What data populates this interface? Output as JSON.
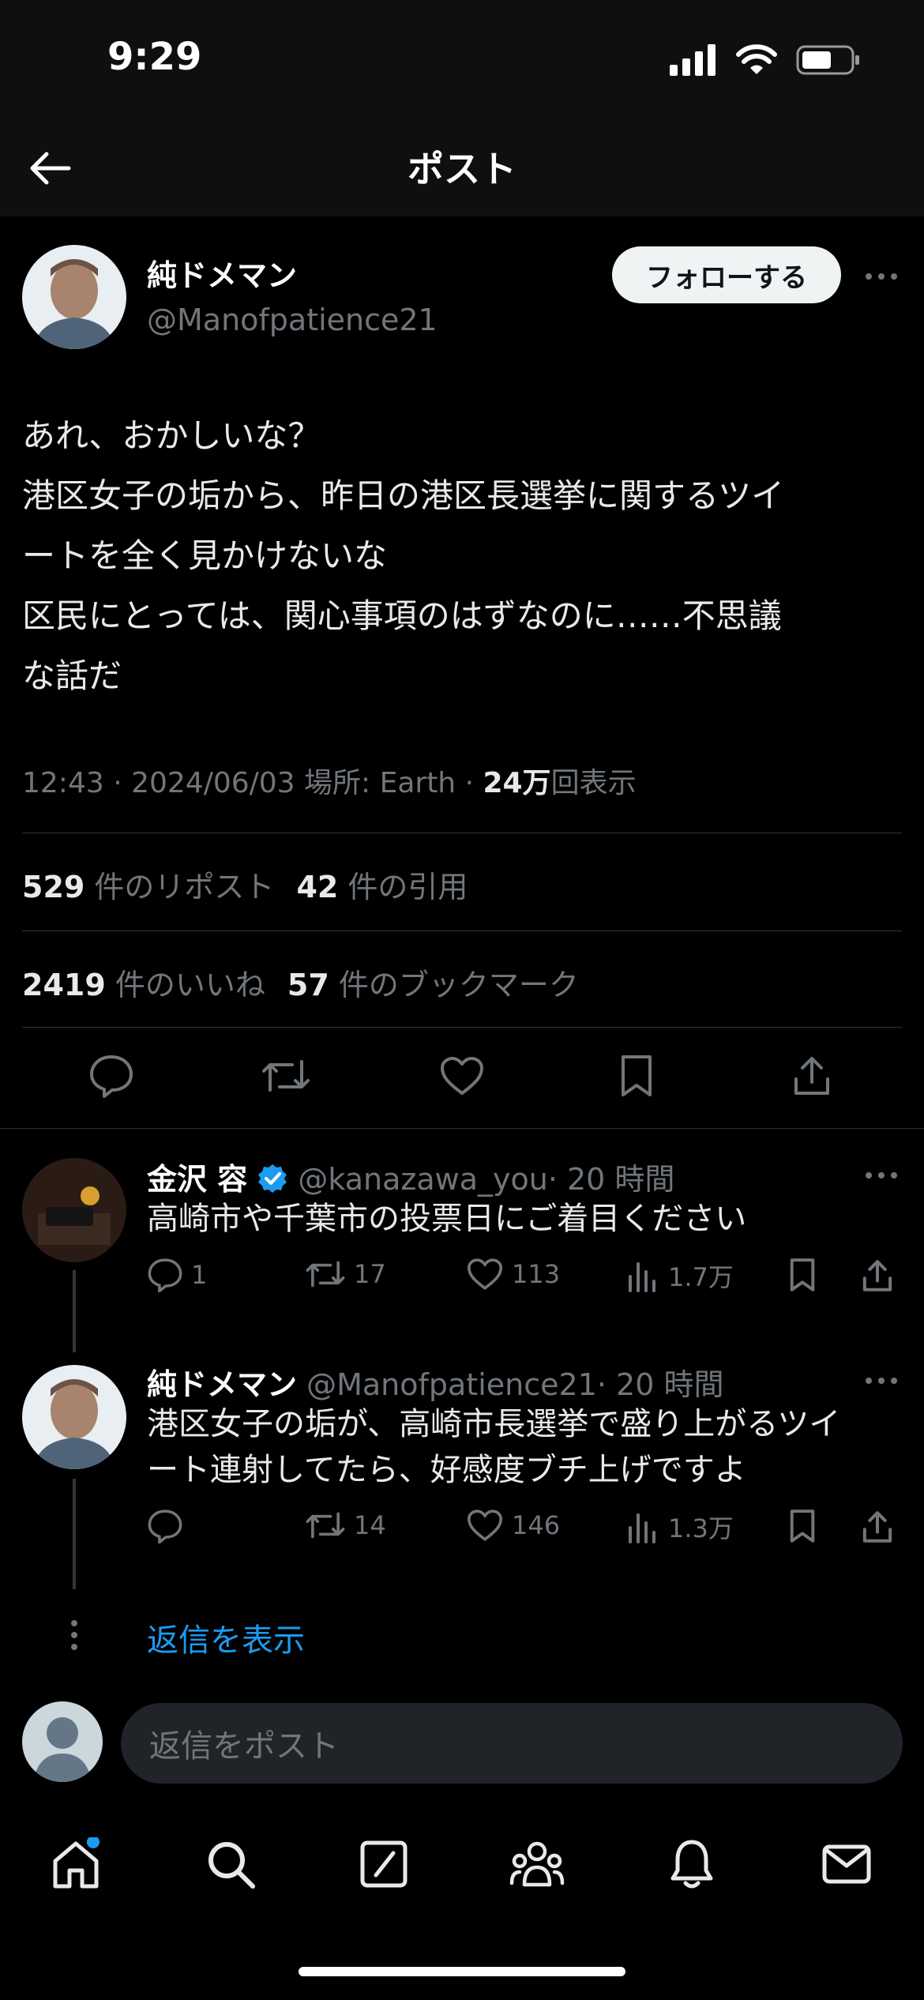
{
  "status": {
    "time": "9:29"
  },
  "topbar": {
    "title": "ポスト"
  },
  "post": {
    "author_name": "純ドメマン",
    "author_handle": "@Manofpatience21",
    "follow_label": "フォローする",
    "text_lines": [
      "あれ、おかしいな？",
      "港区女子の垢から、昨日の港区長選挙に関するツイ",
      "ートを全く見かけないな",
      "区民にとっては、関心事項のはずなのに……不思議",
      "な話だ"
    ],
    "meta_prefix": "12:43 · 2024/06/03 場所: Earth · ",
    "views_count": "24万",
    "views_label": "回表示",
    "reposts_count": "529",
    "reposts_label": "件のリポスト",
    "quotes_count": "42",
    "quotes_label": "件の引用",
    "likes_count": "2419",
    "likes_label": "件のいいね",
    "bookmarks_count": "57",
    "bookmarks_label": "件のブックマーク"
  },
  "replies": [
    {
      "name": "金沢 容",
      "verified": true,
      "handle": "@kanazawa_you",
      "time": "· 20 時間",
      "text": "高崎市や千葉市の投票日にご着目ください",
      "reply_count": "1",
      "repost_count": "17",
      "like_count": "113",
      "view_count": "1.7万"
    },
    {
      "name": "純ドメマン",
      "verified": false,
      "handle": "@Manofpatience21",
      "time": "· 20 時間",
      "text_lines": [
        "港区女子の垢が、高崎市長選挙で盛り上がるツイ",
        "ート連射してたら、好感度ブチ上げですよ"
      ],
      "reply_count": "",
      "repost_count": "14",
      "like_count": "146",
      "view_count": "1.3万"
    }
  ],
  "show_replies_label": "返信を表示",
  "composer": {
    "placeholder": "返信をポスト"
  },
  "colors": {
    "accent": "#1d9bf0",
    "background": "#000000",
    "muted": "#71767b"
  },
  "icons": [
    "back-arrow-icon",
    "more-icon",
    "reply-icon",
    "repost-icon",
    "like-icon",
    "bookmark-icon",
    "share-icon",
    "views-icon",
    "verified-icon",
    "home-icon",
    "search-icon",
    "compose-icon",
    "communities-icon",
    "notifications-icon",
    "messages-icon"
  ]
}
